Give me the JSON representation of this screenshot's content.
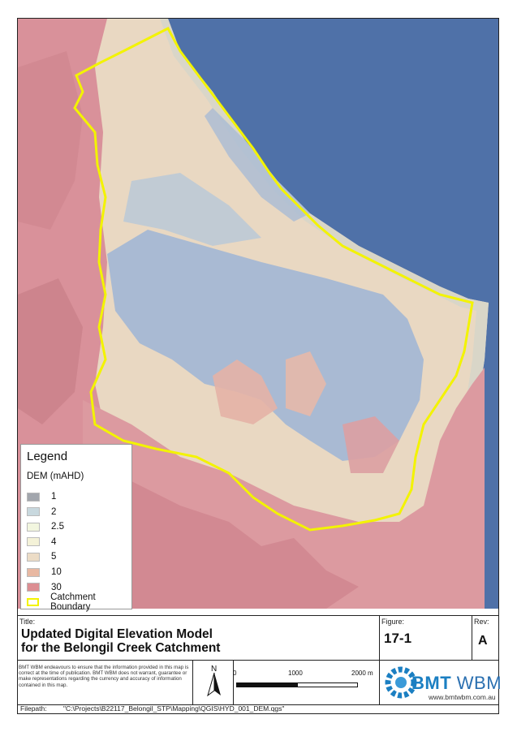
{
  "legend": {
    "title": "Legend",
    "subtitle": "DEM (mAHD)",
    "items": [
      {
        "label": "1",
        "color": "#a2a6ad"
      },
      {
        "label": "2",
        "color": "#c8d8de"
      },
      {
        "label": "2.5",
        "color": "#f2f6df"
      },
      {
        "label": "4",
        "color": "#f4f2d8"
      },
      {
        "label": "5",
        "color": "#ecdcc6"
      },
      {
        "label": "10",
        "color": "#e8b8a2"
      },
      {
        "label": "30",
        "color": "#dc8e92"
      }
    ],
    "boundary_label": "Catchment Boundary",
    "boundary_color": "#f3f300"
  },
  "title_block": {
    "title_label": "Title:",
    "title_line1": "Updated Digital Elevation Model",
    "title_line2": "for the Belongil Creek Catchment",
    "figure_label": "Figure:",
    "figure_number": "17-1",
    "rev_label": "Rev:",
    "rev_value": "A",
    "disclaimer": "BMT WBM endeavours to ensure that the information provided in this map is correct at the time of publication. BMT WBM does not warrant, guarantee or make representations regarding the currency and accuracy of information contained in this map.",
    "north_label": "N",
    "scale_labels": [
      "0",
      "1000",
      "2000 m"
    ],
    "logo_bmt": "BMT",
    "logo_wbm": "WBM",
    "website": "www.bmtwbm.com.au",
    "filepath_label": "Filepath:",
    "filepath_value": "\"C:\\Projects\\B22117_Belongil_STP\\Mapping\\QGIS\\HYD_001_DEM.qgs\""
  },
  "colors": {
    "ocean": "#4f71a8",
    "boundary": "#f3f300",
    "brand": "#1b7fc2"
  }
}
